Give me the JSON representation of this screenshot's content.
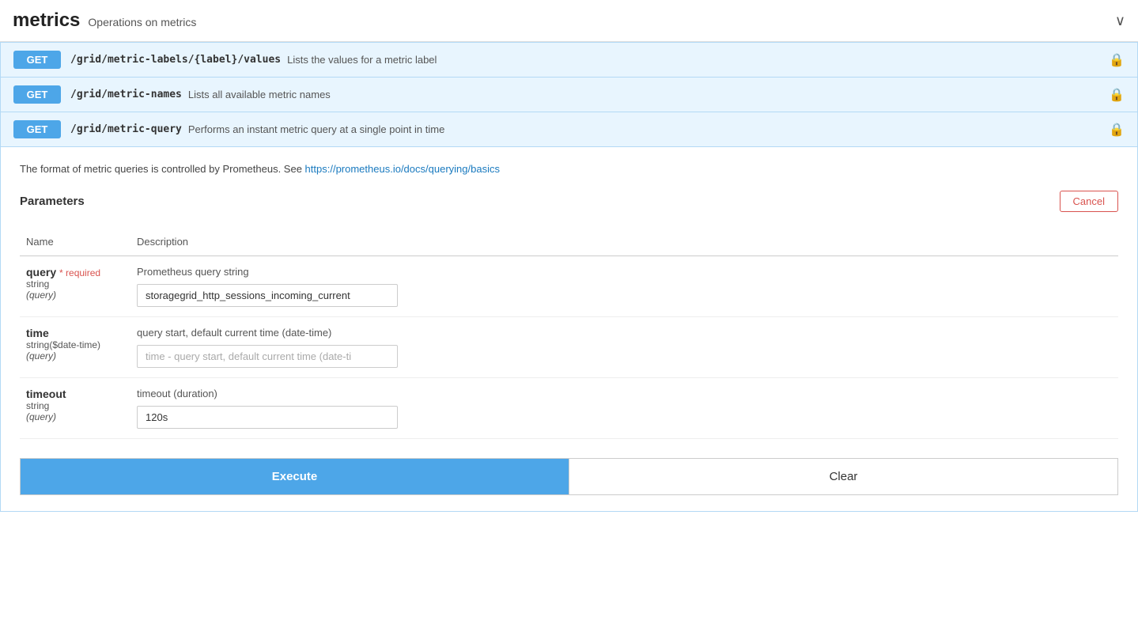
{
  "header": {
    "title": "metrics",
    "subtitle": "Operations on metrics",
    "chevron": "∨"
  },
  "endpoints": [
    {
      "method": "GET",
      "path": "/grid/metric-labels/{label}/values",
      "description": "Lists the values for a metric label",
      "id": "endpoint-label-values"
    },
    {
      "method": "GET",
      "path": "/grid/metric-names",
      "description": "Lists all available metric names",
      "id": "endpoint-metric-names"
    },
    {
      "method": "GET",
      "path": "/grid/metric-query",
      "description": "Performs an instant metric query at a single point in time",
      "id": "endpoint-metric-query"
    }
  ],
  "expanded": {
    "note_prefix": "The format of metric queries is controlled by Prometheus. See ",
    "note_link_text": "https://prometheus.io/docs/querying/basics",
    "note_link_url": "https://prometheus.io/docs/querying/basics",
    "params_title": "Parameters",
    "cancel_label": "Cancel",
    "parameters": [
      {
        "name": "query",
        "required": true,
        "required_label": "* required",
        "type": "string",
        "location": "(query)",
        "description": "Prometheus query string",
        "value": "storagegrid_http_sessions_incoming_current",
        "placeholder": "",
        "id": "param-query"
      },
      {
        "name": "time",
        "required": false,
        "type": "string($date-time)",
        "location": "(query)",
        "description": "query start, default current time (date-time)",
        "value": "",
        "placeholder": "time - query start, default current time (date-ti",
        "id": "param-time"
      },
      {
        "name": "timeout",
        "required": false,
        "type": "string",
        "location": "(query)",
        "description": "timeout (duration)",
        "value": "120s",
        "placeholder": "",
        "id": "param-timeout"
      }
    ],
    "execute_label": "Execute",
    "clear_label": "Clear"
  },
  "columns": {
    "name": "Name",
    "description": "Description"
  }
}
